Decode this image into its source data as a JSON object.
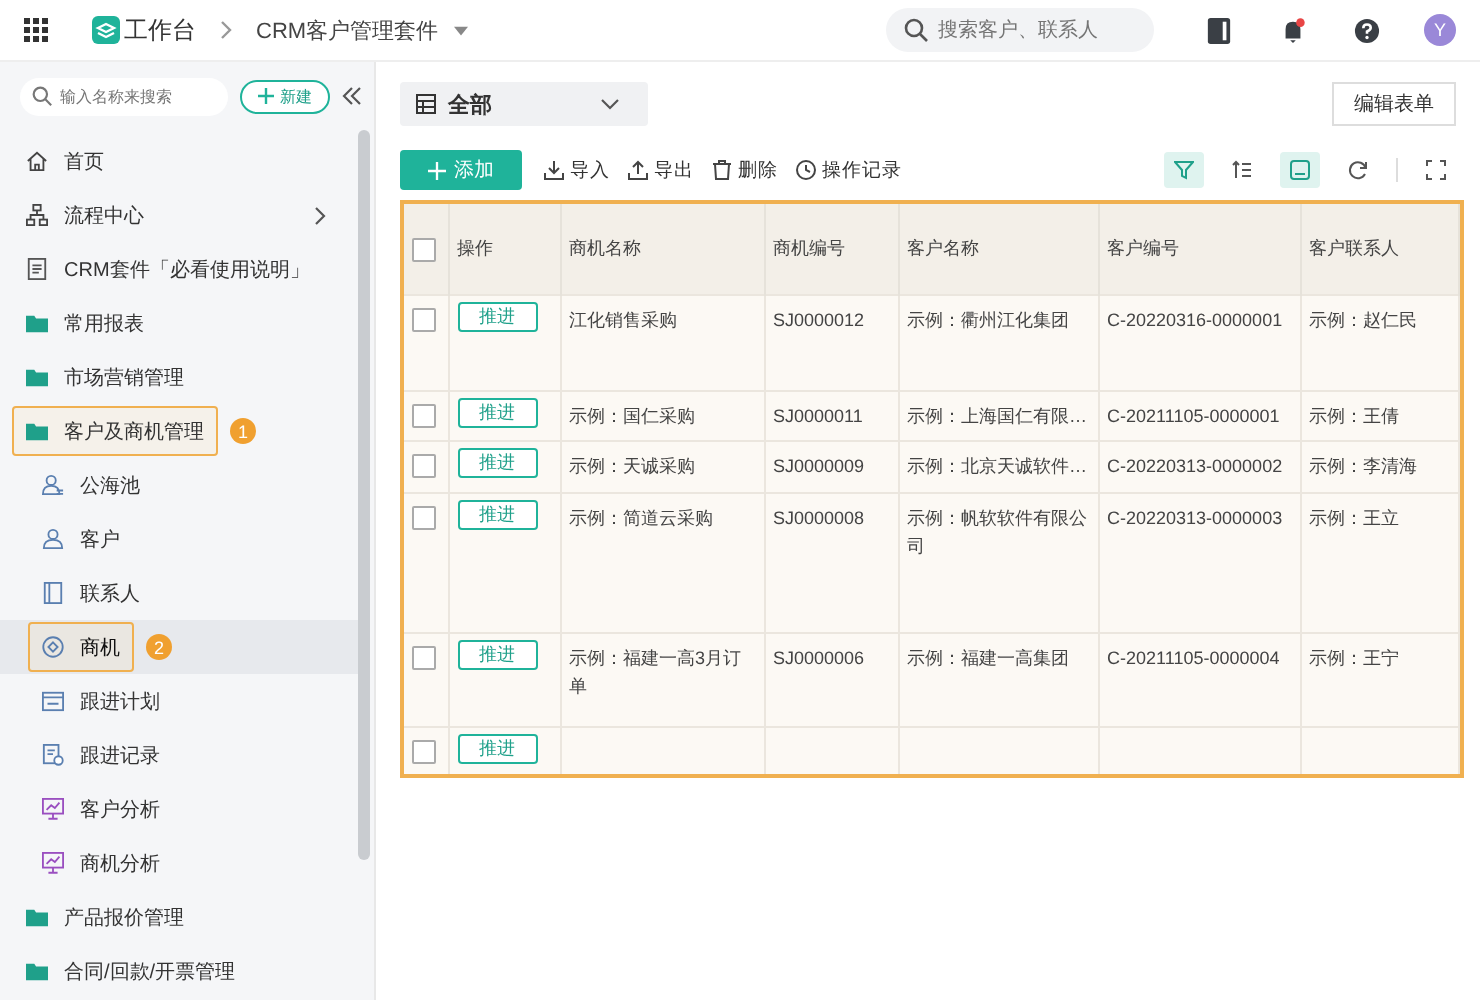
{
  "topbar": {
    "app": "工作台",
    "suite": "CRM客户管理套件",
    "search_placeholder": "搜索客户、联系人",
    "avatar": "Y"
  },
  "sidebar": {
    "search_placeholder": "输入名称来搜索",
    "new_button": "新建",
    "items": [
      {
        "kind": "home",
        "label": "首页",
        "highlighted": false,
        "selected": false
      },
      {
        "kind": "flow",
        "label": "流程中心",
        "highlighted": false,
        "selected": false
      },
      {
        "kind": "doc",
        "label": "CRM套件「必看使用说明」",
        "highlighted": false,
        "selected": false
      },
      {
        "kind": "folder",
        "label": "常用报表",
        "highlighted": false,
        "selected": false
      },
      {
        "kind": "folder",
        "label": "市场营销管理",
        "highlighted": false,
        "selected": false
      },
      {
        "kind": "folder",
        "label": "客户及商机管理",
        "highlighted": true,
        "selected": false,
        "annotation": "1",
        "children": [
          {
            "kind": "people",
            "label": "公海池",
            "highlighted": false,
            "selected": false
          },
          {
            "kind": "person",
            "label": "客户",
            "highlighted": false,
            "selected": false
          },
          {
            "kind": "contact",
            "label": "联系人",
            "highlighted": false,
            "selected": false
          },
          {
            "kind": "target",
            "label": "商机",
            "highlighted": true,
            "selected": true,
            "annotation": "2"
          },
          {
            "kind": "plan",
            "label": "跟进计划",
            "highlighted": false,
            "selected": false
          },
          {
            "kind": "record",
            "label": "跟进记录",
            "highlighted": false,
            "selected": false
          },
          {
            "kind": "analysis",
            "label": "客户分析",
            "highlighted": false,
            "selected": false
          },
          {
            "kind": "analysis",
            "label": "商机分析",
            "highlighted": false,
            "selected": false
          }
        ]
      },
      {
        "kind": "folder",
        "label": "产品报价管理",
        "highlighted": false,
        "selected": false
      },
      {
        "kind": "folder",
        "label": "合同/回款/开票管理",
        "highlighted": false,
        "selected": false
      }
    ]
  },
  "view": {
    "label": "全部",
    "edit_button": "编辑表单"
  },
  "toolbar": {
    "add_button": "添加",
    "actions": [
      {
        "kind": "import",
        "label": "导入"
      },
      {
        "kind": "export",
        "label": "导出"
      },
      {
        "kind": "delete",
        "label": "删除"
      },
      {
        "kind": "history",
        "label": "操作记录"
      }
    ],
    "tools": [
      {
        "kind": "filter",
        "selected": true
      },
      {
        "kind": "sort",
        "selected": false
      },
      {
        "kind": "card",
        "selected": true
      },
      {
        "kind": "refresh",
        "selected": false
      },
      {
        "kind": "fullscreen",
        "selected": false
      }
    ]
  },
  "table": {
    "highlighted": true,
    "all_checked": false,
    "columns": [
      "操作",
      "商机名称",
      "商机编号",
      "客户名称",
      "客户编号",
      "客户联系人"
    ],
    "rows": [
      {
        "checked": false,
        "action": "推进",
        "cells": [
          "江化销售采购",
          "SJ0000012",
          "示例：衢州江化集团",
          "C-20220316-0000001",
          "示例：赵仁民"
        ]
      },
      {
        "checked": false,
        "action": "推进",
        "cells": [
          "示例：国仁采购",
          "SJ0000011",
          "示例：上海国仁有限…",
          "C-20211105-0000001",
          "示例：王倩"
        ]
      },
      {
        "checked": false,
        "action": "推进",
        "cells": [
          "示例：天诚采购",
          "SJ0000009",
          "示例：北京天诚软件…",
          "C-20220313-0000002",
          "示例：李清海"
        ]
      },
      {
        "checked": false,
        "action": "推进",
        "cells": [
          "示例：简道云采购",
          "SJ0000008",
          "示例：帆软软件有限公司",
          "C-20220313-0000003",
          "示例：王立"
        ]
      },
      {
        "checked": false,
        "action": "推进",
        "cells": [
          "示例：福建一高3月订单",
          "SJ0000006",
          "示例：福建一高集团",
          "C-20211105-0000004",
          "示例：王宁"
        ]
      },
      {
        "checked": false,
        "action": "推进"
      }
    ]
  }
}
